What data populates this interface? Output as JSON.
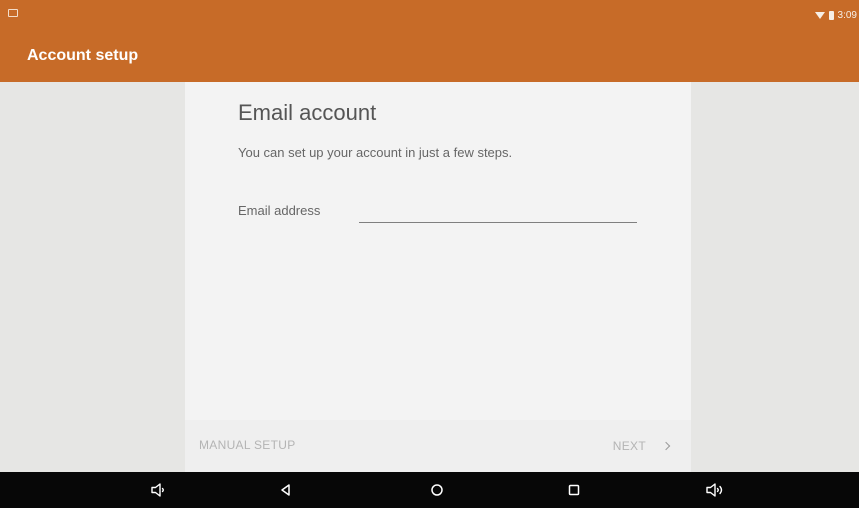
{
  "status_bar": {
    "time": "3:09",
    "icons": [
      "screenshot-icon",
      "wifi-icon",
      "battery-icon"
    ]
  },
  "app_bar": {
    "title": "Account setup"
  },
  "card": {
    "title": "Email account",
    "subtitle": "You can set up your account in just a few steps.",
    "email_field": {
      "label": "Email address",
      "value": "",
      "placeholder": ""
    },
    "footer": {
      "manual_setup_label": "MANUAL SETUP",
      "next_label": "NEXT"
    }
  },
  "nav_bar": {
    "buttons": [
      "volume-down-icon",
      "back-icon",
      "home-icon",
      "recents-icon",
      "volume-up-icon"
    ]
  },
  "colors": {
    "accent": "#c76b28",
    "background": "#e6e6e4",
    "card": "#f3f3f3",
    "nav_bar": "#070707"
  }
}
